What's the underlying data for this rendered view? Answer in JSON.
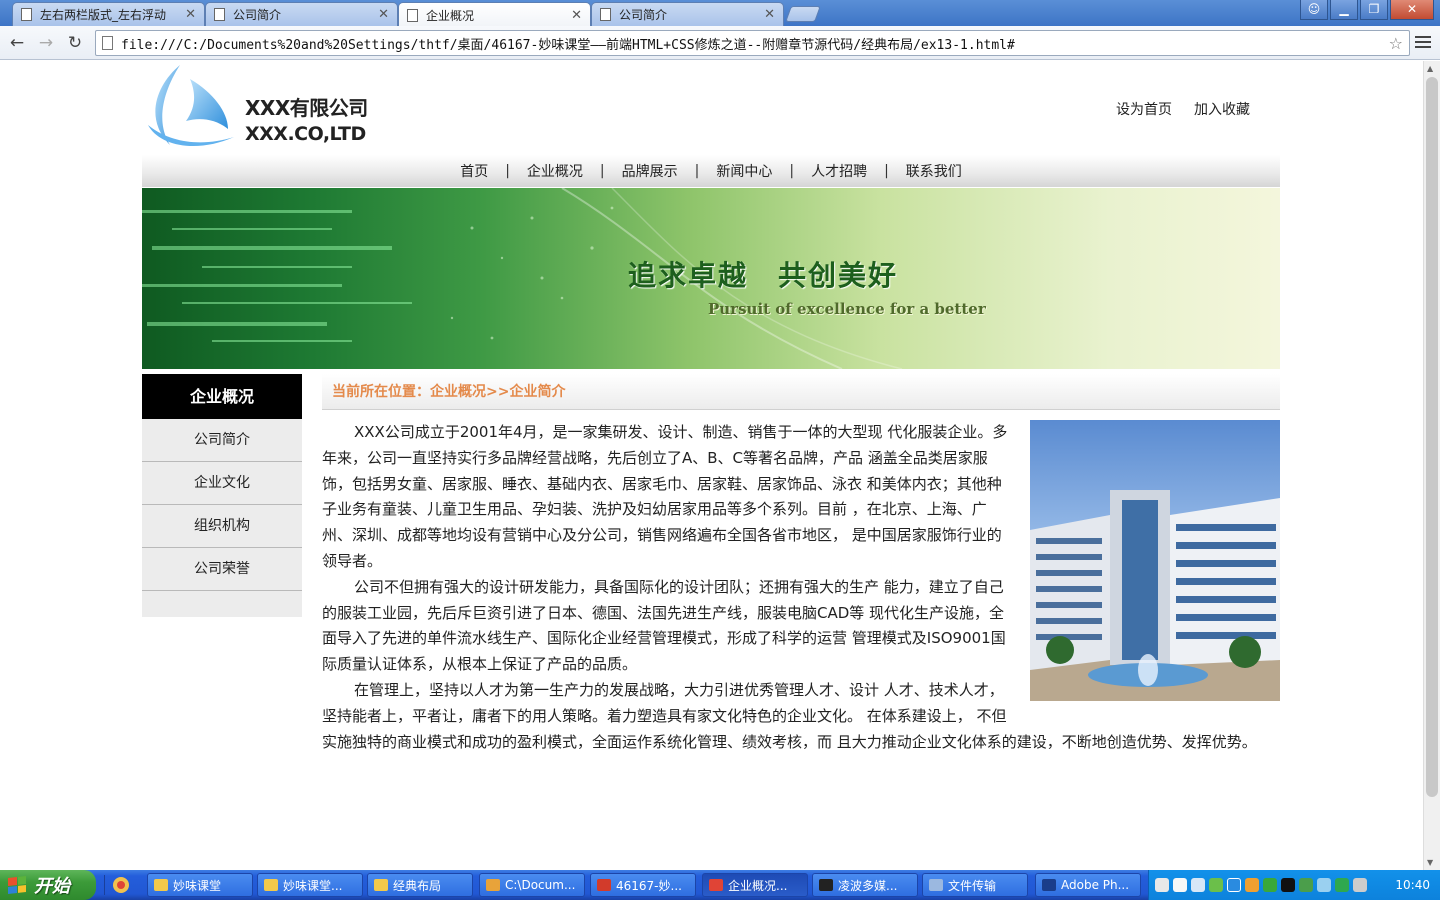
{
  "browser": {
    "tabs": [
      {
        "label": "左右两栏版式_左右浮动",
        "active": false
      },
      {
        "label": "公司简介",
        "active": false
      },
      {
        "label": "企业概况",
        "active": true
      },
      {
        "label": "公司简介",
        "active": false
      }
    ],
    "url": "file:///C:/Documents%20and%20Settings/thtf/桌面/46167-妙味课堂——前端HTML+CSS修炼之道--附赠章节源代码/经典布局/ex13-1.html#"
  },
  "site": {
    "brand_cn": "XXX有限公司",
    "brand_en": "XXX.CO,LTD",
    "top_links": [
      "设为首页",
      "加入收藏"
    ],
    "nav": [
      "首页",
      "企业概况",
      "品牌展示",
      "新闻中心",
      "人才招聘",
      "联系我们"
    ],
    "nav_separator": "|",
    "banner_title": "追求卓越　共创美好",
    "banner_sub": "Pursuit of excellence for a better",
    "sidebar_title": "企业概况",
    "sidebar_items": [
      "公司简介",
      "企业文化",
      "组织机构",
      "公司荣誉"
    ],
    "breadcrumb": "当前所在位置：企业概况>>企业简介",
    "paragraphs": [
      "XXX公司成立于2001年4月，是一家集研发、设计、制造、销售于一体的大型现 代化服装企业。多年来，公司一直坚持实行多品牌经营战略，先后创立了A、B、C等著名品牌，产品 涵盖全品类居家服饰，包括男女童、居家服、睡衣、基础内衣、居家毛巾、居家鞋、居家饰品、泳衣 和美体内衣；其他种子业务有童装、儿童卫生用品、孕妇装、洗护及妇幼居家用品等多个系列。目前 ，在北京、上海、广州、深圳、成都等地均设有营销中心及分公司，销售网络遍布全国各省市地区， 是中国居家服饰行业的领导者。",
      "公司不但拥有强大的设计研发能力，具备国际化的设计团队；还拥有强大的生产 能力，建立了自己的服装工业园，先后斥巨资引进了日本、德国、法国先进生产线，服装电脑CAD等 现代化生产设施，全面导入了先进的单件流水线生产、国际化企业经营管理模式，形成了科学的运营 管理模式及ISO9001国际质量认证体系，从根本上保证了产品的品质。",
      "在管理上，坚持以人才为第一生产力的发展战略，大力引进优秀管理人才、设计 人才、技术人才，坚持能者上，平者让，庸者下的用人策略。着力塑造具有家文化特色的企业文化。 在体系建设上， 不但实施独特的商业模式和成功的盈利模式，全面运作系统化管理、绩效考核，而 且大力推动企业文化体系的建设，不断地创造优势、发挥优势。"
    ]
  },
  "taskbar": {
    "start_label": "开始",
    "items": [
      {
        "label": "妙味课堂",
        "active": false,
        "icon_color": "#f3c94b"
      },
      {
        "label": "妙味课堂...",
        "active": false,
        "icon_color": "#f3c94b"
      },
      {
        "label": "经典布局",
        "active": false,
        "icon_color": "#f3c94b"
      },
      {
        "label": "C:\\Docum...",
        "active": false,
        "icon_color": "#e8a33a"
      },
      {
        "label": "46167-妙...",
        "active": false,
        "icon_color": "#d23b2b"
      },
      {
        "label": "企业概况...",
        "active": true,
        "icon_color": "#e04436"
      },
      {
        "label": "凌波多媒...",
        "active": false,
        "icon_color": "#222222"
      },
      {
        "label": "文件传输",
        "active": false,
        "icon_color": "#9bb8e0"
      },
      {
        "label": "Adobe Ph...",
        "active": false,
        "icon_color": "#1a3d8a"
      }
    ],
    "clock": "10:40"
  },
  "colors": {
    "breadcrumb_text": "#e48a4b",
    "sidebar_head_bg": "#000000",
    "sidebar_bg": "#ececec"
  }
}
